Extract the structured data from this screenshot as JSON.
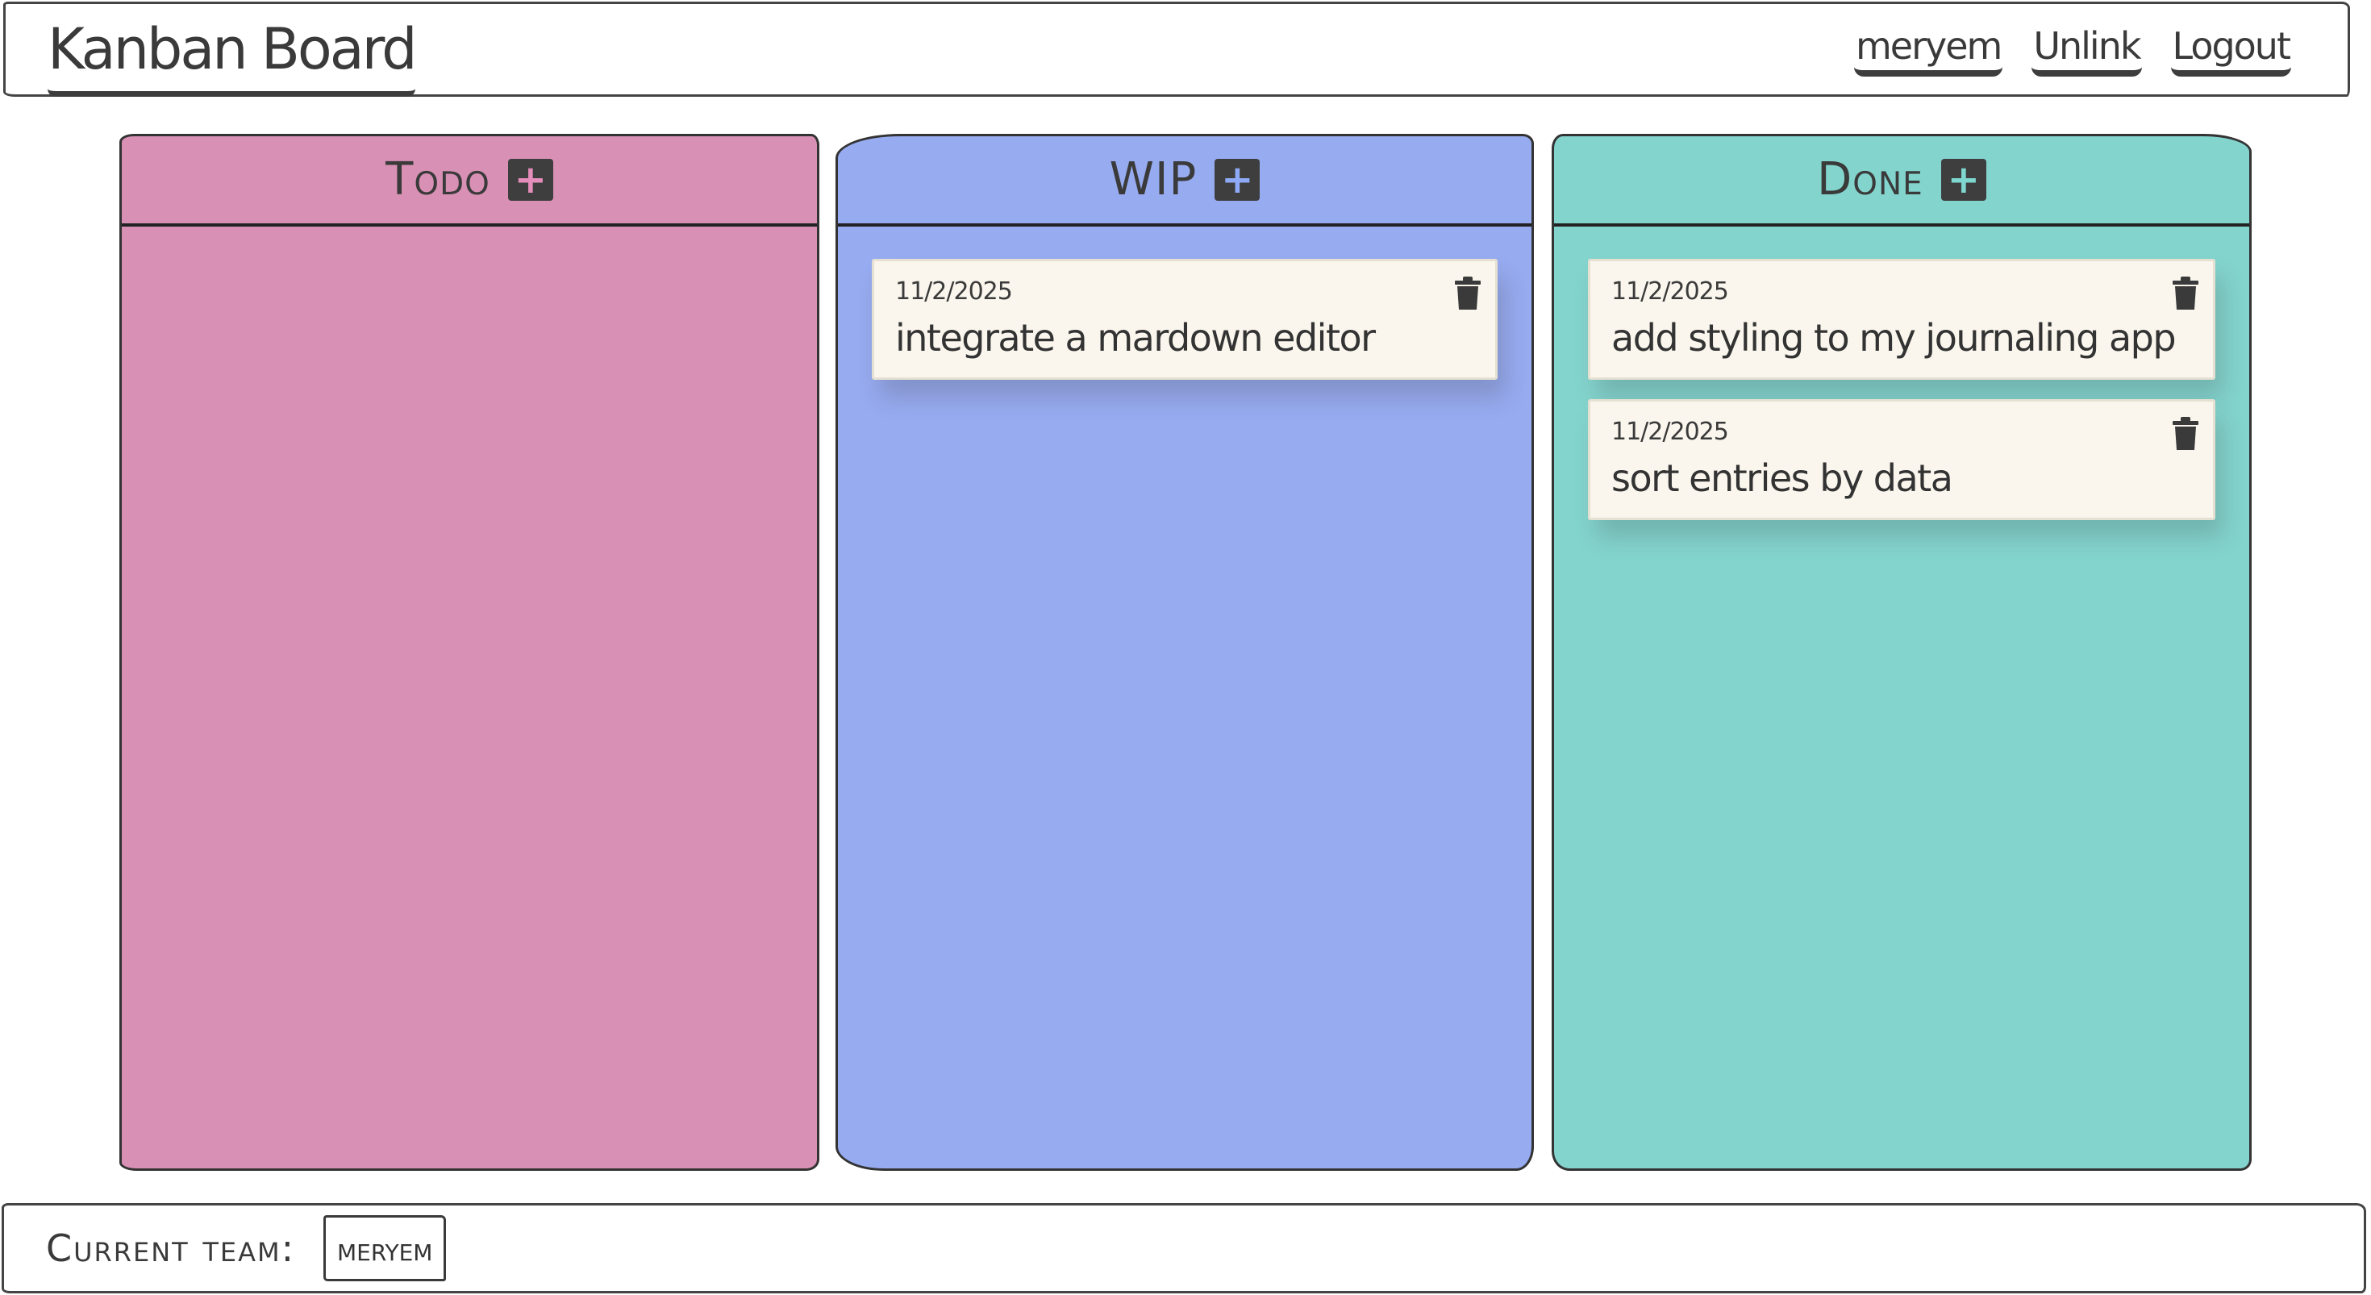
{
  "header": {
    "title": "Kanban Board",
    "nav": [
      "meryem",
      "Unlink",
      "Logout"
    ]
  },
  "columns": [
    {
      "title": "Todo",
      "color": "#d990b5",
      "accent": "#e58dbb",
      "add_label": "+",
      "cards": []
    },
    {
      "title": "WIP",
      "color": "#97abf0",
      "accent": "#8eaaf6",
      "add_label": "+",
      "cards": [
        {
          "date": "11/2/2025",
          "text": "integrate a mardown editor"
        }
      ]
    },
    {
      "title": "Done",
      "color": "#84d4ce",
      "accent": "#7fd8d0",
      "add_label": "+",
      "cards": [
        {
          "date": "11/2/2025",
          "text": "add styling to my journaling app"
        },
        {
          "date": "11/2/2025",
          "text": "sort entries by data"
        }
      ]
    }
  ],
  "footer": {
    "label": "Current team:",
    "team": "meryem"
  },
  "icons": {
    "add": "plus-icon",
    "delete": "trash-icon"
  }
}
